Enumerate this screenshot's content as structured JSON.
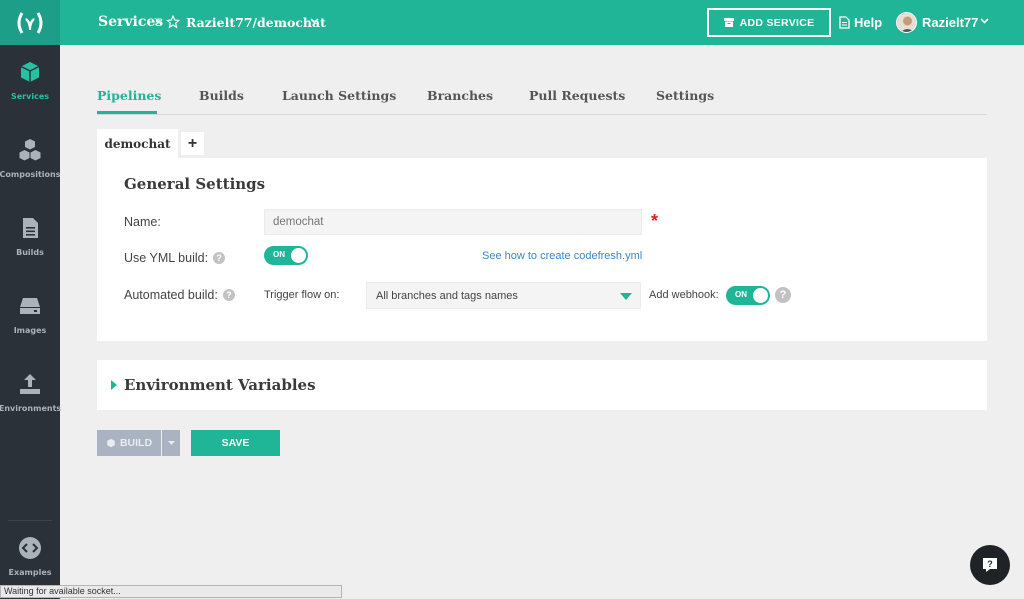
{
  "sidebar": {
    "items": [
      {
        "label": "Services"
      },
      {
        "label": "Compositions"
      },
      {
        "label": "Builds"
      },
      {
        "label": "Images"
      },
      {
        "label": "Environments"
      },
      {
        "label": "Examples"
      }
    ]
  },
  "topbar": {
    "breadcrumb_root": "Services",
    "breadcrumb_separator": ">",
    "repo": "Razielt77/demochat",
    "add_service_label": "ADD SERVICE",
    "help_label": "Help",
    "username": "Razielt77"
  },
  "tabs": [
    {
      "label": "Pipelines",
      "active": true
    },
    {
      "label": "Builds"
    },
    {
      "label": "Launch Settings"
    },
    {
      "label": "Branches"
    },
    {
      "label": "Pull Requests"
    },
    {
      "label": "Settings"
    }
  ],
  "pipeline_tabs": {
    "current": "demochat",
    "add_label": "+"
  },
  "general_settings": {
    "title": "General Settings",
    "name_label": "Name:",
    "name_placeholder": "demochat",
    "required_mark": "*",
    "yml_label": "Use YML build:",
    "yml_toggle": "ON",
    "yml_link": "See how to create codefresh.yml",
    "automated_label": "Automated build:",
    "trigger_label": "Trigger flow on:",
    "trigger_value": "All branches and tags names",
    "webhook_label": "Add webhook:",
    "webhook_toggle": "ON",
    "help_mark": "?"
  },
  "env_section": {
    "title": "Environment Variables"
  },
  "actions": {
    "build_label": "BUILD",
    "save_label": "SAVE"
  },
  "status_text": "Waiting for available socket...",
  "colors": {
    "accent": "#20b597",
    "sidebar": "#2b3138",
    "link": "#3a87c9"
  }
}
